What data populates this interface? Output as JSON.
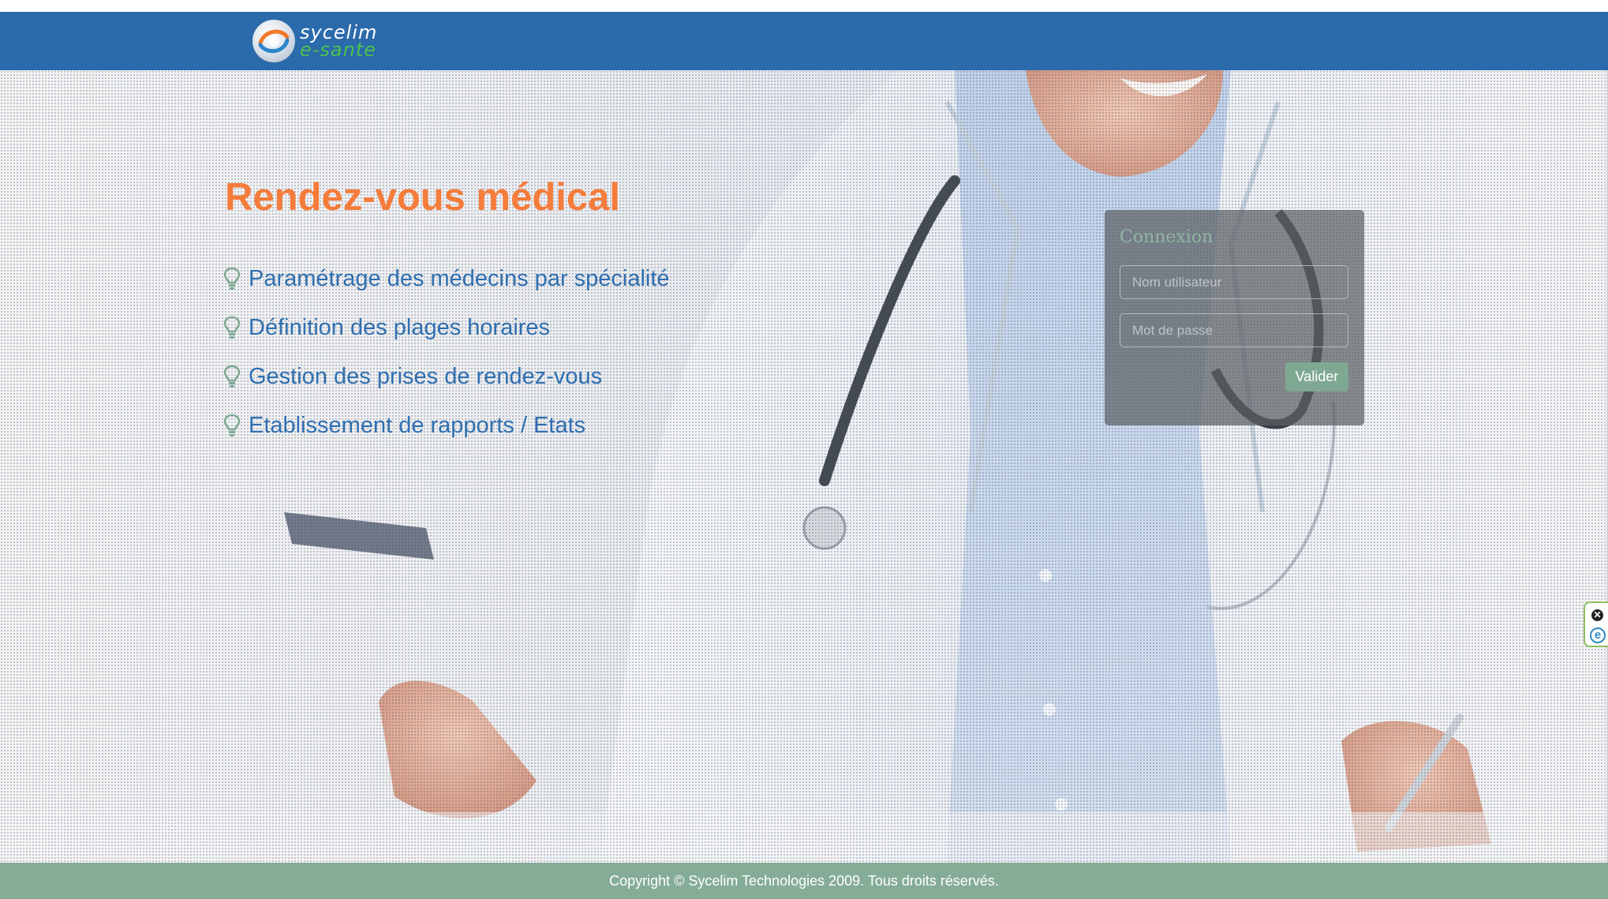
{
  "header": {
    "logo_line1": "sycelim",
    "logo_line2": "e-sante"
  },
  "hero": {
    "title": "Rendez-vous médical",
    "features": [
      "Paramétrage des médecins par spécialité",
      "Définition des plages horaires",
      "Gestion des prises de rendez-vous",
      "Etablissement de rapports / Etats"
    ]
  },
  "login": {
    "title": "Connexion",
    "username_placeholder": "Nom utilisateur",
    "password_placeholder": "Mot de passe",
    "submit_label": "Valider"
  },
  "side_widget": {
    "close_glyph": "✕",
    "logo_glyph": "e"
  },
  "footer": {
    "copyright": "Copyright © Sycelim Technologies 2009. Tous droits réservés."
  },
  "colors": {
    "header": "#2b6aab",
    "title": "#f57c3a",
    "feature_text": "#2f6fb0",
    "accent_green": "#85ac97",
    "logo_green": "#4cc24e"
  }
}
